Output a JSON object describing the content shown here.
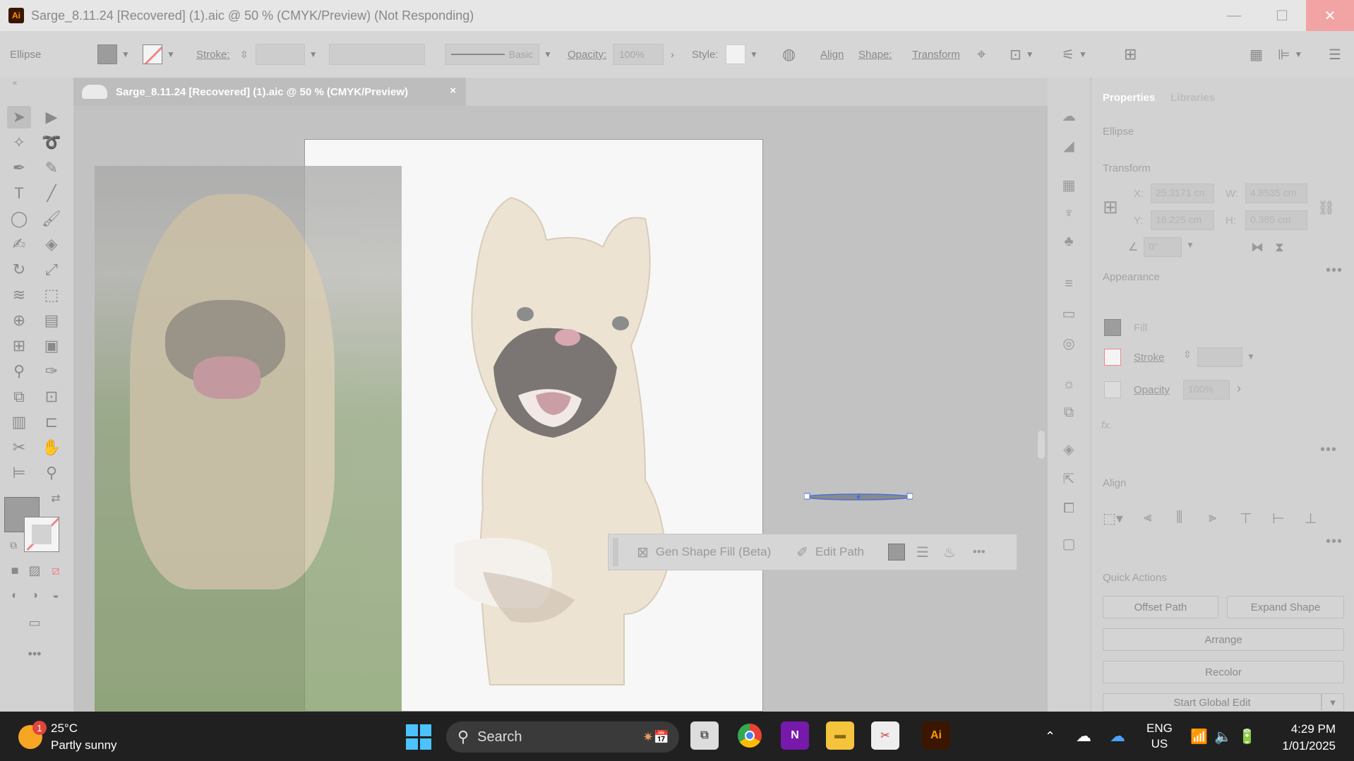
{
  "window": {
    "title": "Sarge_8.11.24 [Recovered] (1).aic @ 50 % (CMYK/Preview)  (Not Responding)",
    "app_logo": "Ai",
    "controls": [
      "minimize",
      "maximize",
      "close"
    ]
  },
  "control_bar": {
    "object_type": "Ellipse",
    "stroke_label": "Stroke:",
    "brush_label": "Basic",
    "opacity_label": "Opacity:",
    "opacity_value": "100%",
    "style_label": "Style:",
    "align_label": "Align",
    "shape_label": "Shape:",
    "transform_label": "Transform"
  },
  "document_tab": {
    "title": "Sarge_8.11.24 [Recovered] (1).aic @ 50 % (CMYK/Preview)",
    "close": "×"
  },
  "contextual_task_bar": {
    "gen_shape_fill": "Gen Shape Fill (Beta)",
    "edit_path": "Edit Path",
    "more": "•••"
  },
  "properties_panel": {
    "tabs": [
      "Properties",
      "Libraries"
    ],
    "object_type": "Ellipse",
    "transform": {
      "heading": "Transform",
      "x_label": "X:",
      "x_value": "25.3171 cn",
      "y_label": "Y:",
      "y_value": "16.225 cm",
      "w_label": "W:",
      "w_value": "4.8535 cm",
      "h_label": "H:",
      "h_value": "0.385 cm",
      "angle_value": "0°"
    },
    "appearance": {
      "heading": "Appearance",
      "fill_label": "Fill",
      "stroke_label": "Stroke",
      "opacity_label": "Opacity",
      "opacity_value": "100%",
      "fx_label": "fx."
    },
    "align": {
      "heading": "Align"
    },
    "quick_actions": {
      "heading": "Quick Actions",
      "offset_path": "Offset Path",
      "expand_shape": "Expand Shape",
      "arrange": "Arrange",
      "recolor": "Recolor",
      "start_global_edit": "Start Global Edit"
    }
  },
  "taskbar": {
    "weather_temp": "25°C",
    "weather_desc": "Partly sunny",
    "weather_badge": "1",
    "search_label": "Search",
    "language": "ENG",
    "region": "US",
    "time": "4:29 PM",
    "date": "1/01/2025",
    "ai_app": "Ai",
    "onenote_app": "N"
  },
  "colors": {
    "accent_close": "#e81123",
    "ai_orange": "#ff9a00",
    "windows_blue": "#4cc2ff",
    "selection_blue": "#4a6fd8"
  }
}
